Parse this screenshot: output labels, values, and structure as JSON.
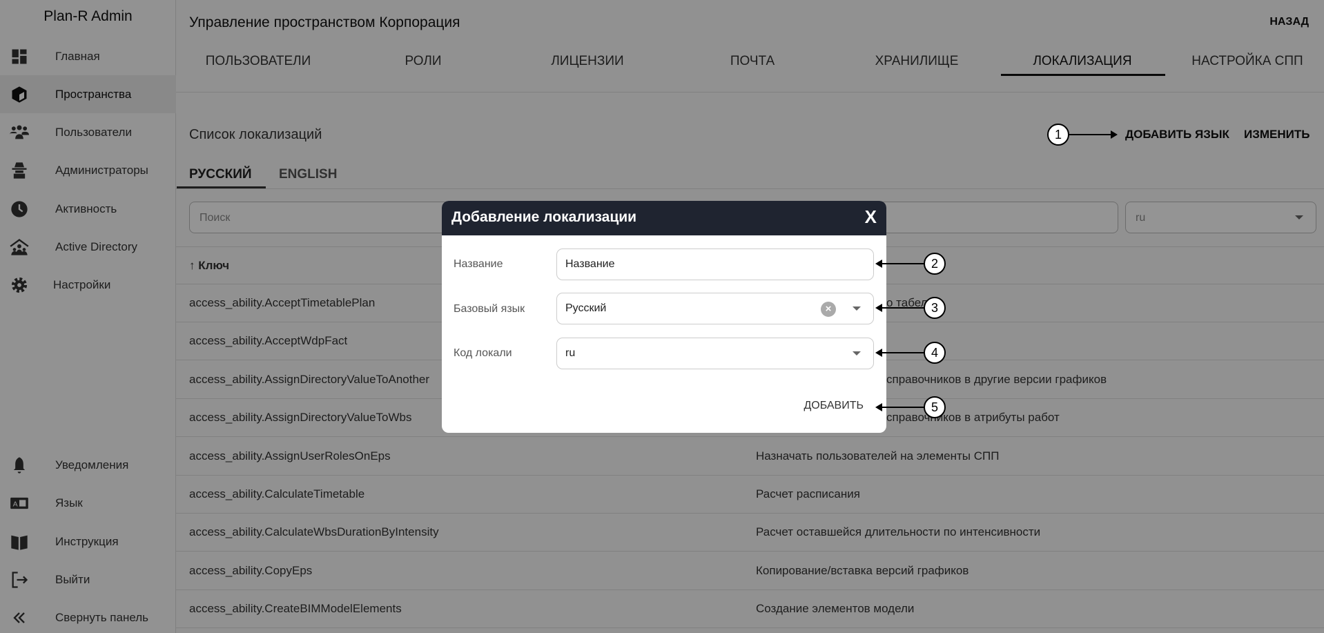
{
  "sidebar": {
    "brand": "Plan-R Admin",
    "items": [
      {
        "label": "Главная",
        "icon": "dashboard-icon"
      },
      {
        "label": "Пространства",
        "icon": "cube-icon",
        "active": true
      },
      {
        "label": "Пользователи",
        "icon": "users-icon"
      },
      {
        "label": "Администраторы",
        "icon": "spy-icon"
      },
      {
        "label": "Активность",
        "icon": "clock-icon"
      },
      {
        "label": "Active Directory",
        "icon": "org-icon"
      },
      {
        "label": "Настройки",
        "icon": "gear-icon"
      }
    ],
    "bottom": [
      {
        "label": "Уведомления",
        "icon": "bell-icon"
      },
      {
        "label": "Язык",
        "icon": "translate-icon"
      },
      {
        "label": "Инструкция",
        "icon": "book-icon"
      },
      {
        "label": "Выйти",
        "icon": "logout-icon"
      },
      {
        "label": "Свернуть панель",
        "icon": "chevrons-left-icon"
      }
    ]
  },
  "header": {
    "title": "Управление пространством Корпорация",
    "back": "НАЗАД",
    "tabs": [
      "ПОЛЬЗОВАТЕЛИ",
      "РОЛИ",
      "ЛИЦЕНЗИИ",
      "ПОЧТА",
      "ХРАНИЛИЩЕ",
      "ЛОКАЛИЗАЦИЯ",
      "НАСТРОЙКА СПП"
    ],
    "active_tab": "ЛОКАЛИЗАЦИЯ"
  },
  "main": {
    "subtitle": "Список локализаций",
    "add_language": "ДОБАВИТЬ ЯЗЫК",
    "edit": "ИЗМЕНИТЬ",
    "lang_tabs": [
      "РУССКИЙ",
      "ENGLISH"
    ],
    "active_lang_tab": "РУССКИЙ",
    "search_placeholder": "Поиск",
    "locale_select": "ru",
    "key_header": "↑ Ключ",
    "rows": [
      {
        "key": "access_ability.AcceptTimetablePlan",
        "value": "о табел"
      },
      {
        "key": "access_ability.AcceptWdpFact",
        "value": ""
      },
      {
        "key": "access_ability.AssignDirectoryValueToAnother",
        "value": "справочников в другие версии графиков"
      },
      {
        "key": "access_ability.AssignDirectoryValueToWbs",
        "value": "справочников в атрибуты работ"
      },
      {
        "key": "access_ability.AssignUserRolesOnEps",
        "value": "Назначать пользователей на элементы СПП"
      },
      {
        "key": "access_ability.CalculateTimetable",
        "value": "Расчет расписания"
      },
      {
        "key": "access_ability.CalculateWbsDurationByIntensity",
        "value": "Расчет оставшейся длительности по интенсивности"
      },
      {
        "key": "access_ability.CopyEps",
        "value": "Копирование/вставка версий графиков"
      },
      {
        "key": "access_ability.CreateBIMModelElements",
        "value": "Создание элементов модели"
      }
    ]
  },
  "dialog": {
    "title": "Добавление локализации",
    "close": "X",
    "name_label": "Название",
    "name_value": "Название",
    "base_label": "Базовый язык",
    "base_value": "Русский",
    "code_label": "Код локали",
    "code_value": "ru",
    "submit": "ДОБАВИТЬ"
  },
  "callouts": [
    "1",
    "2",
    "3",
    "4",
    "5"
  ],
  "colors": {
    "dialog_header": "#1f2430",
    "overlay": "rgba(0,0,0,0.42)"
  }
}
